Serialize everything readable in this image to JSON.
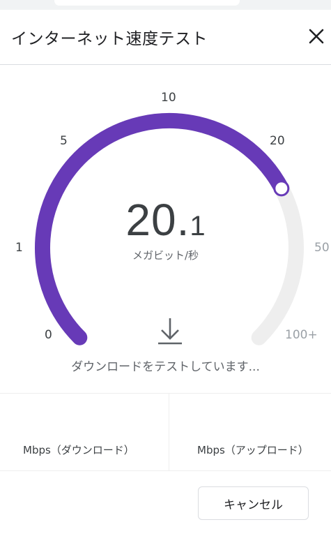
{
  "dialog": {
    "title": "インターネット速度テスト"
  },
  "gauge": {
    "ticks": {
      "t0": "0",
      "t1": "1",
      "t5": "5",
      "t10": "10",
      "t20": "20",
      "t50": "50",
      "t100": "100+"
    },
    "speed_integer": "20.",
    "speed_decimal": "1",
    "unit": "メガビット/秒",
    "progress_fraction": 0.73,
    "accent_color": "#673ab7",
    "track_color": "#eeeeee"
  },
  "status": "ダウンロードをテストしています...",
  "results": {
    "download_label": "Mbps（ダウンロード）",
    "upload_label": "Mbps（アップロード）"
  },
  "actions": {
    "cancel_label": "キャンセル"
  },
  "icons": {
    "close": "close-icon",
    "download": "download-icon"
  }
}
